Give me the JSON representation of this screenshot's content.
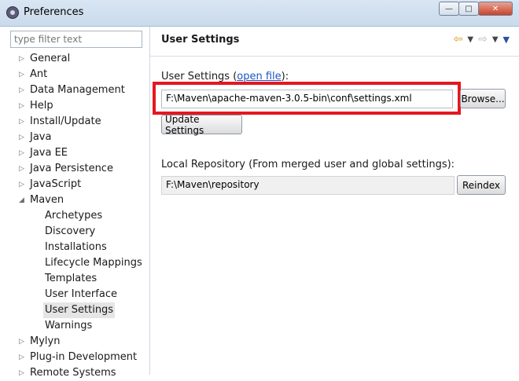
{
  "window": {
    "title": "Preferences",
    "minimize_glyph": "—",
    "maximize_glyph": "□",
    "close_glyph": "✕"
  },
  "sidebar": {
    "filter_placeholder": "type filter text",
    "items": [
      {
        "label": "General",
        "expanded": false,
        "level": 0
      },
      {
        "label": "Ant",
        "expanded": false,
        "level": 0
      },
      {
        "label": "Data Management",
        "expanded": false,
        "level": 0
      },
      {
        "label": "Help",
        "expanded": false,
        "level": 0
      },
      {
        "label": "Install/Update",
        "expanded": false,
        "level": 0
      },
      {
        "label": "Java",
        "expanded": false,
        "level": 0
      },
      {
        "label": "Java EE",
        "expanded": false,
        "level": 0
      },
      {
        "label": "Java Persistence",
        "expanded": false,
        "level": 0
      },
      {
        "label": "JavaScript",
        "expanded": false,
        "level": 0
      },
      {
        "label": "Maven",
        "expanded": true,
        "level": 0
      },
      {
        "label": "Archetypes",
        "level": 1
      },
      {
        "label": "Discovery",
        "level": 1
      },
      {
        "label": "Installations",
        "level": 1
      },
      {
        "label": "Lifecycle Mappings",
        "level": 1
      },
      {
        "label": "Templates",
        "level": 1
      },
      {
        "label": "User Interface",
        "level": 1
      },
      {
        "label": "User Settings",
        "level": 1,
        "selected": true
      },
      {
        "label": "Warnings",
        "level": 1
      },
      {
        "label": "Mylyn",
        "expanded": false,
        "level": 0
      },
      {
        "label": "Plug-in Development",
        "expanded": false,
        "level": 0
      },
      {
        "label": "Remote Systems",
        "expanded": false,
        "level": 0
      }
    ]
  },
  "main": {
    "title": "User Settings",
    "user_settings_label": "User Settings (",
    "open_file_link": "open file",
    "user_settings_label_end": "):",
    "user_settings_value": "F:\\Maven\\apache-maven-3.0.5-bin\\conf\\settings.xml",
    "browse_label": "Browse...",
    "update_label": "Update Settings",
    "local_repo_label": "Local Repository (From merged user and global settings):",
    "local_repo_value": "F:\\Maven\\repository",
    "reindex_label": "Reindex",
    "highlight_color": "#e5171f"
  }
}
